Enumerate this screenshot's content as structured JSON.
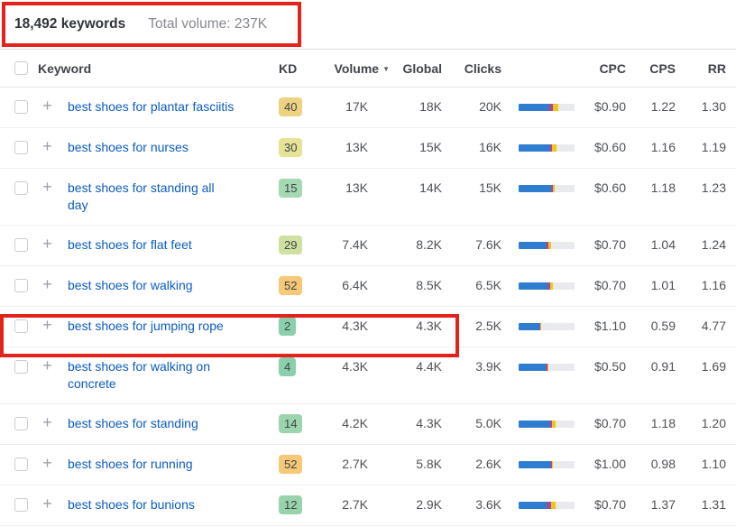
{
  "summary": {
    "keywords_count": "18,492 keywords",
    "total_volume": "Total volume: 237K"
  },
  "table": {
    "headers": {
      "keyword": "Keyword",
      "kd": "KD",
      "volume": "Volume",
      "volume_sort_icon": "▼",
      "global": "Global",
      "clicks": "Clicks",
      "cpc": "CPC",
      "cps": "CPS",
      "rr": "RR"
    },
    "rows": [
      {
        "keyword": "best shoes for plantar fasciitis",
        "kd": "40",
        "kd_color": "#edd27f",
        "volume": "17K",
        "global": "18K",
        "clicks": "20K",
        "bar": {
          "organic_pct": 53,
          "mixed_pct": 8,
          "paid_pct": 10
        },
        "cpc": "$0.90",
        "cps": "1.22",
        "rr": "1.30",
        "highlighted": false
      },
      {
        "keyword": "best shoes for nurses",
        "kd": "30",
        "kd_color": "#e4e396",
        "volume": "13K",
        "global": "15K",
        "clicks": "16K",
        "bar": {
          "organic_pct": 55,
          "mixed_pct": 5,
          "paid_pct": 8
        },
        "cpc": "$0.60",
        "cps": "1.16",
        "rr": "1.19",
        "highlighted": false
      },
      {
        "keyword": "best shoes for standing all day",
        "kd": "15",
        "kd_color": "#a4d9b1",
        "volume": "13K",
        "global": "14K",
        "clicks": "15K",
        "bar": {
          "organic_pct": 58,
          "mixed_pct": 4,
          "paid_pct": 3
        },
        "cpc": "$0.60",
        "cps": "1.18",
        "rr": "1.23",
        "highlighted": false
      },
      {
        "keyword": "best shoes for flat feet",
        "kd": "29",
        "kd_color": "#cfe1a1",
        "volume": "7.4K",
        "global": "8.2K",
        "clicks": "7.6K",
        "bar": {
          "organic_pct": 48,
          "mixed_pct": 5,
          "paid_pct": 5
        },
        "cpc": "$0.70",
        "cps": "1.04",
        "rr": "1.24",
        "highlighted": false
      },
      {
        "keyword": "best shoes for walking",
        "kd": "52",
        "kd_color": "#f6c877",
        "volume": "6.4K",
        "global": "8.5K",
        "clicks": "6.5K",
        "bar": {
          "organic_pct": 52,
          "mixed_pct": 5,
          "paid_pct": 5
        },
        "cpc": "$0.70",
        "cps": "1.01",
        "rr": "1.16",
        "highlighted": false
      },
      {
        "keyword": "best shoes for jumping rope",
        "kd": "2",
        "kd_color": "#8bd0ab",
        "volume": "4.3K",
        "global": "4.3K",
        "clicks": "2.5K",
        "bar": {
          "organic_pct": 37,
          "mixed_pct": 1,
          "paid_pct": 2
        },
        "cpc": "$1.10",
        "cps": "0.59",
        "rr": "4.77",
        "highlighted": true
      },
      {
        "keyword": "best shoes for walking on concrete",
        "kd": "4",
        "kd_color": "#8bd0ab",
        "volume": "4.3K",
        "global": "4.4K",
        "clicks": "3.9K",
        "bar": {
          "organic_pct": 48,
          "mixed_pct": 3,
          "paid_pct": 3
        },
        "cpc": "$0.50",
        "cps": "0.91",
        "rr": "1.69",
        "highlighted": false
      },
      {
        "keyword": "best shoes for standing",
        "kd": "14",
        "kd_color": "#9cd5ad",
        "volume": "4.2K",
        "global": "4.3K",
        "clicks": "5.0K",
        "bar": {
          "organic_pct": 55,
          "mixed_pct": 5,
          "paid_pct": 6
        },
        "cpc": "$0.70",
        "cps": "1.18",
        "rr": "1.20",
        "highlighted": false
      },
      {
        "keyword": "best shoes for running",
        "kd": "52",
        "kd_color": "#f6c877",
        "volume": "2.7K",
        "global": "5.8K",
        "clicks": "2.6K",
        "bar": {
          "organic_pct": 56,
          "mixed_pct": 3,
          "paid_pct": 3
        },
        "cpc": "$1.00",
        "cps": "0.98",
        "rr": "1.10",
        "highlighted": false
      },
      {
        "keyword": "best shoes for bunions",
        "kd": "12",
        "kd_color": "#98d4ab",
        "volume": "2.7K",
        "global": "2.9K",
        "clicks": "3.6K",
        "bar": {
          "organic_pct": 50,
          "mixed_pct": 8,
          "paid_pct": 8
        },
        "cpc": "$0.70",
        "cps": "1.37",
        "rr": "1.31",
        "highlighted": false
      }
    ]
  },
  "colors": {
    "bar_organic": "#2e7dd1",
    "bar_mixed": "#9a4e9e",
    "bar_paid": "#f3c512",
    "bar_track": "#e9eaed",
    "annotation_red": "#e3221b",
    "link_blue": "#0b5cc2"
  }
}
